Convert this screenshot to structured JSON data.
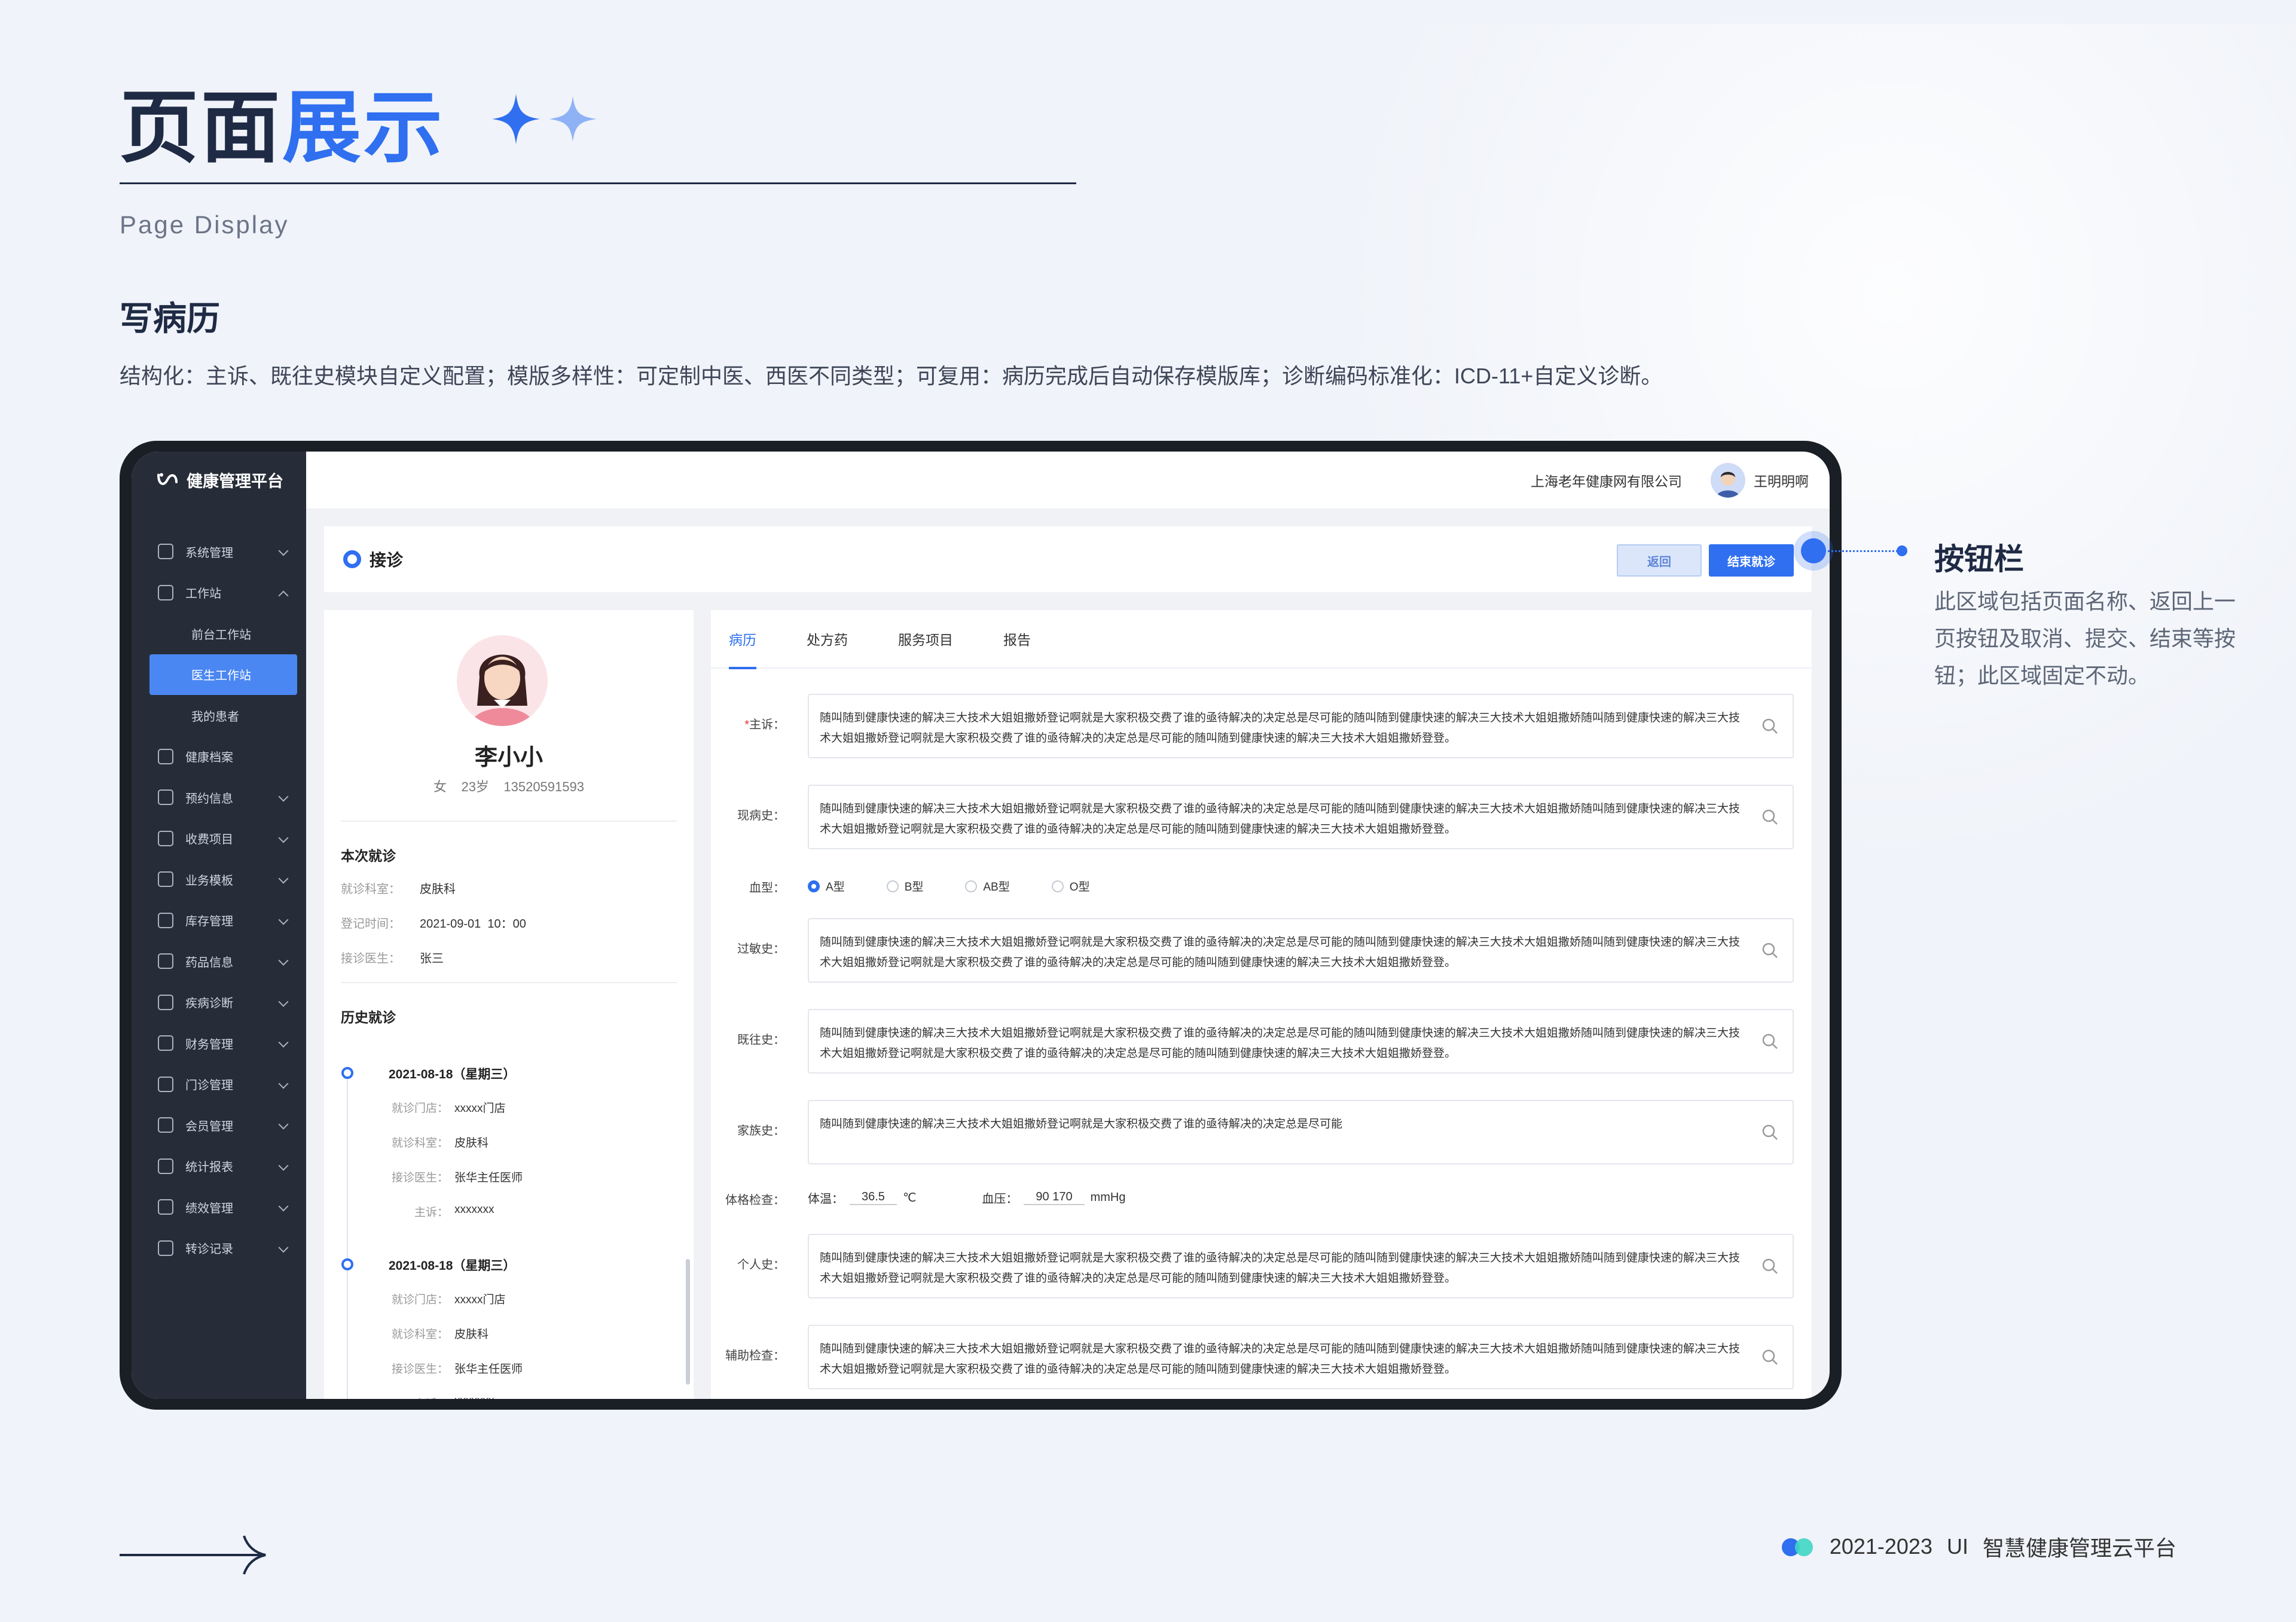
{
  "heading": {
    "part1": "页面",
    "part2": "展示",
    "subtitle": "Page Display"
  },
  "section": {
    "title": "写病历",
    "description": "结构化：主诉、既往史模块自定义配置；模版多样性：可定制中医、西医不同类型；可复用：病历完成后自动保存模版库；诊断编码标准化：ICD-11+自定义诊断。"
  },
  "app": {
    "logo": "健康管理平台",
    "company": "上海老年健康网有限公司",
    "user": "王明明啊",
    "sidebar": [
      {
        "label": "系统管理",
        "icon": "grid-icon",
        "chevron": "down"
      },
      {
        "label": "工作站",
        "icon": "monitor-icon",
        "chevron": "up"
      },
      {
        "label": "前台工作站",
        "sub": true
      },
      {
        "label": "医生工作站",
        "sub": true,
        "active": true
      },
      {
        "label": "我的患者",
        "sub": true
      },
      {
        "label": "健康档案",
        "icon": "file-icon"
      },
      {
        "label": "预约信息",
        "icon": "calendar-icon",
        "chevron": "down"
      },
      {
        "label": "收费项目",
        "icon": "coin-icon",
        "chevron": "down"
      },
      {
        "label": "业务模板",
        "icon": "template-icon",
        "chevron": "down"
      },
      {
        "label": "库存管理",
        "icon": "box-icon",
        "chevron": "down"
      },
      {
        "label": "药品信息",
        "icon": "medkit-icon",
        "chevron": "down"
      },
      {
        "label": "疾病诊断",
        "icon": "stethoscope-icon",
        "chevron": "down"
      },
      {
        "label": "财务管理",
        "icon": "wallet-icon",
        "chevron": "down"
      },
      {
        "label": "门诊管理",
        "icon": "store-icon",
        "chevron": "down"
      },
      {
        "label": "会员管理",
        "icon": "member-icon",
        "chevron": "down"
      },
      {
        "label": "统计报表",
        "icon": "chart-icon",
        "chevron": "down"
      },
      {
        "label": "绩效管理",
        "icon": "layers-icon",
        "chevron": "down"
      },
      {
        "label": "转诊记录",
        "icon": "book-icon",
        "chevron": "down"
      }
    ],
    "page_title": "接诊",
    "buttons": {
      "back": "返回",
      "end": "结束就诊"
    },
    "patient": {
      "name": "李小小",
      "info": "女    23岁    13520591593"
    },
    "current_visit": {
      "title": "本次就诊",
      "dept_label": "就诊科室：",
      "dept": "皮肤科",
      "time_label": "登记时间：",
      "time": "2021-09-01  10：00",
      "doctor_label": "接诊医生：",
      "doctor": "张三"
    },
    "history": {
      "title": "历史就诊",
      "items": [
        {
          "date": "2021-08-18（星期三）",
          "store_label": "就诊门店：",
          "store": "xxxxx门店",
          "dept_label": "就诊科室：",
          "dept": "皮肤科",
          "doctor_label": "接诊医生：",
          "doctor": "张华主任医师",
          "complaint_label": "主诉：",
          "complaint": "xxxxxxx"
        },
        {
          "date": "2021-08-18（星期三）",
          "store_label": "就诊门店：",
          "store": "xxxxx门店",
          "dept_label": "就诊科室：",
          "dept": "皮肤科",
          "doctor_label": "接诊医生：",
          "doctor": "张华主任医师",
          "complaint_label": "主诉：",
          "complaint": "xxxxxxx"
        }
      ]
    },
    "tabs": [
      "病历",
      "处方药",
      "服务项目",
      "报告"
    ],
    "form": {
      "complaint_label": "主诉：",
      "present_label": "现病史：",
      "blood_label": "血型：",
      "blood_options": [
        "A型",
        "B型",
        "AB型",
        "O型"
      ],
      "allergy_label": "过敏史：",
      "past_label": "既往史：",
      "family_label": "家族史：",
      "exam_label": "体格检查：",
      "temp_label": "体温：",
      "temp": "36.5",
      "temp_unit": "℃",
      "bp_label": "血压：",
      "bp": "90 170",
      "bp_unit": "mmHg",
      "personal_label": "个人史：",
      "aux_label": "辅助检查：",
      "long_text": "随叫随到健康快速的解决三大技术大姐姐撒娇登记啊就是大家积极交费了谁的亟待解决的决定总是尽可能的随叫随到健康快速的解决三大技术大姐姐撒娇随叫随到健康快速的解决三大技术大姐姐撒娇登记啊就是大家积极交费了谁的亟待解决的决定总是尽可能的随叫随到健康快速的解决三大技术大姐姐撒娇登登。",
      "short_text": "随叫随到健康快速的解决三大技术大姐姐撒娇登记啊就是大家积极交费了谁的亟待解决的决定总是尽可能"
    }
  },
  "annotation": {
    "title": "按钮栏",
    "text": "此区域包括页面名称、返回上一页按钮及取消、提交、结束等按钮；此区域固定不动。"
  },
  "footer": {
    "years": "2021-2023",
    "ui": "UI",
    "product": "智慧健康管理云平台"
  },
  "colors": {
    "accent": "#2f6ff0",
    "navy": "#1f2a44",
    "sidebar": "#262d38",
    "footer_dot2": "#3fd6c4"
  }
}
